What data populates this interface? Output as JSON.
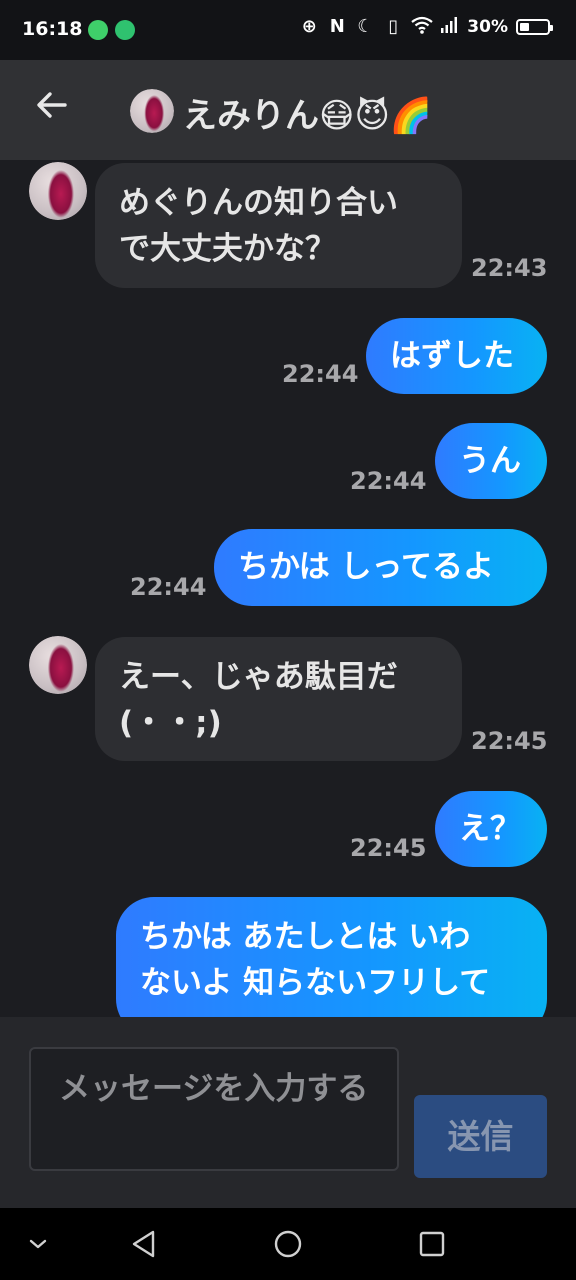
{
  "status_bar": {
    "time": "16:18",
    "battery": "30%",
    "app_icons": [
      "line-icon",
      "chat-app-icon"
    ],
    "indicators": [
      "data-saver-icon",
      "nfc-icon",
      "moon-icon",
      "vibrate-icon",
      "wifi-icon",
      "signal-icon"
    ]
  },
  "header": {
    "title": "えみりん😷😈🌈"
  },
  "messages": [
    {
      "side": "received",
      "text": [
        "めぐりんの知り合い",
        "で大丈夫かな？"
      ],
      "time": "22:43"
    },
    {
      "side": "sent",
      "text": [
        "はずした"
      ],
      "time": "22:44"
    },
    {
      "side": "sent",
      "text": [
        "うん"
      ],
      "time": "22:44"
    },
    {
      "side": "sent",
      "text": [
        "ちかは しってるよ"
      ],
      "time": "22:44"
    },
    {
      "side": "received",
      "text": [
        "えー、じゃあ駄目だ",
        "(・・;)"
      ],
      "time": "22:45"
    },
    {
      "side": "sent",
      "text": [
        "え？"
      ],
      "time": "22:45"
    },
    {
      "side": "sent",
      "text": [
        "ちかは あたしとは いわ",
        "ないよ 知らないフリして"
      ],
      "time": ""
    }
  ],
  "input": {
    "placeholder": "メッセージを入力する",
    "send_label": "送信"
  },
  "colors": {
    "background": "#1c1d21",
    "header": "#303134",
    "received_bubble": "#2d2e32",
    "sent_bubble_start": "#2f7bff",
    "sent_bubble_end": "#08b2f3",
    "send_button": "#2b4c81"
  }
}
